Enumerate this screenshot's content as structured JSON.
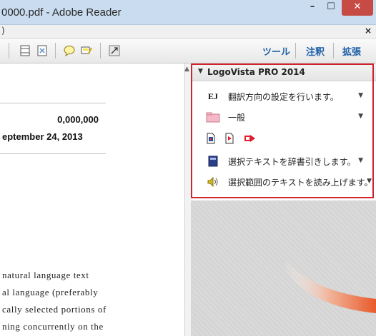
{
  "window": {
    "title": "0000.pdf - Adobe Reader",
    "min_glyph": "–",
    "max_glyph": "☐",
    "close_glyph": "✕",
    "menu_paren": ")",
    "menu_close": "×"
  },
  "toolbar": {
    "tools_label": "ツール",
    "comment_label": "注釈",
    "extend_label": "拡張"
  },
  "document": {
    "number": "0,000,000",
    "date": "eptember 24, 2013",
    "lines": [
      " natural language text",
      "al language (preferably",
      "cally selected portions of",
      "ning concurrently on the"
    ]
  },
  "panel": {
    "title": "LogoVista PRO 2014",
    "rows": [
      {
        "label": "翻訳方向の設定を行います。",
        "icon": "ej-translate-icon"
      },
      {
        "label": "一般",
        "icon": "folder-icon"
      },
      {
        "label": "選択テキストを辞書引きします。",
        "icon": "dictionary-icon"
      },
      {
        "label": "選択範囲のテキストを読み上げます。",
        "icon": "speaker-icon"
      }
    ],
    "ej_glyph": "EJ"
  },
  "colors": {
    "highlight_border": "#d0232c",
    "link_blue": "#1c5fa8",
    "close_red": "#c74b45"
  }
}
